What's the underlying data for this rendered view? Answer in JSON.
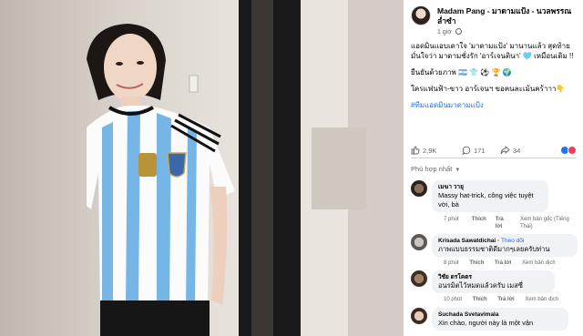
{
  "post": {
    "author": "Madam Pang - มาดามแป้ง - นวลพรรณ ล่ำซำ",
    "time": "1 giờ",
    "caption": [
      "แอดมินแอบเดาใจ 'มาดามแป้ง' มานานแล้ว สุดท้ายมั่นใจว่า มาดามชั่งรัก 'อาร์เจนตินา' 🩵 เหมือนเดิม !!",
      "ยืนยันด้วยภาพ 🇦🇷 👕 ⚽ 🏆 🌍",
      "ใครแฟนฟ้า-ขาว อาร์เจนฯ ขอคนละเม้นคร้าาา👇",
      "#ทีมแอดมินมาดามแป้ง"
    ],
    "likes": "2,9K",
    "comments": "171",
    "shares": "34",
    "filter_label": "Phù hợp nhất"
  },
  "comments": [
    {
      "name": "เมฆา วายุ",
      "text": "Massy hat-trick, công việc tuyệt vời, bà",
      "time": "7 phút",
      "like": "Thích",
      "reply": "Trả lời",
      "extra": "Xem bản gốc (Tiếng Thái)"
    },
    {
      "name": "Krisada Sawatdichai",
      "follow": "Theo dõi",
      "text": "ภาพแบบธรรมชาติดีมากๆเลยครับท่าน",
      "time": "8 phút",
      "like": "Thích",
      "reply": "Trả lời",
      "extra": "Xem bản dịch"
    },
    {
      "name": "วิชัย ดรโคตร",
      "text": "อนรมิตไว้หมดแล้วครับ เมสซี่",
      "time": "10 phút",
      "like": "Thích",
      "reply": "Trả lời",
      "extra": "Xem bản dịch"
    },
    {
      "name": "Suchada Svetavimala",
      "text": "Xin chào, người này là một vận"
    }
  ],
  "colors": {
    "link": "#216fdb",
    "muted": "#65676b",
    "bubble": "#f0f2f5"
  }
}
